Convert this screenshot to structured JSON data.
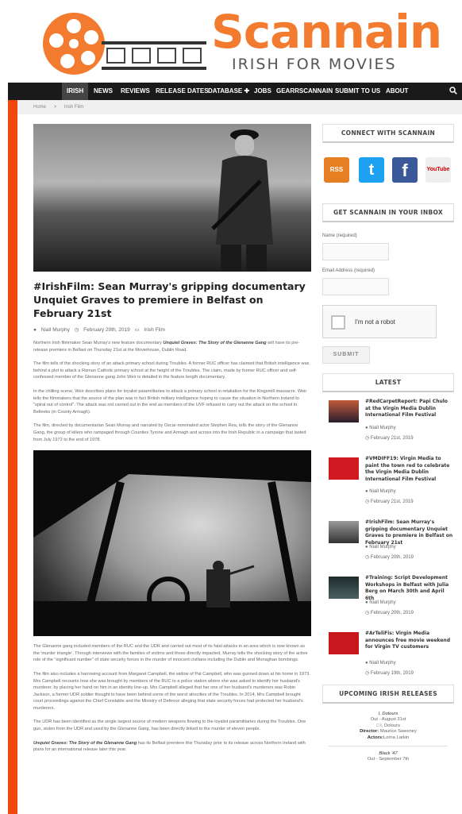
{
  "header": {
    "logo_word": "Scannain",
    "logo_sub": "IRISH FOR MOVIES"
  },
  "nav": {
    "items": [
      "Irish",
      "News",
      "Reviews",
      "Release Dates",
      "Database ✚",
      "Jobs",
      "Gearrscannain",
      "Submit to Us",
      "About"
    ]
  },
  "breadcrumb": {
    "home": "Home",
    "sep": ">",
    "current": "Irish Film"
  },
  "article": {
    "title": "#IrishFilm: Sean Murray's gripping documentary Unquiet Graves to premiere in Belfast on February 21st",
    "author": "Niall Murphy",
    "date": "February 20th, 2019",
    "category": "Irish Film",
    "p1_start": "Northern Irish filmmaker Sean Murray's new feature documentary ",
    "p1_em": "Unquiet Graves: The Story of the Glenanne Gang",
    "p1_end": " will have its pre-release premiere in Belfast on Thursday 21st at the Moviehouse, Dublin Road.",
    "p2": "The film tells of the shocking story of an attack primary school during Troubles. A former RUC officer has claimed that British intelligence was behind a plot to attack a Roman Catholic primary school at the height of the Troubles. The claim, made by former RUC officer and self-confessed member of the Glenanne gang John Weir is detailed in the feature length documentary.",
    "p3": "In the chilling scene, Weir describes plans for loyalist paramilitaries to attack a primary school in retaliation for the Kingsmill massacre. Weir tells the filmmakers that the source of the plan was in fact British military intelligence hoping to cause the situation in Northern Ireland to \"spiral out of control\". The attack was not carried out in the end as members of the UVF refused to carry out the attack on the school in Belleeks (in County Armagh).",
    "p4": "The film, directed by documentarian Sean Murray and narrated by Oscar-nominated actor Stephen Rea, tells the story of the Glenanne Gang, the group of killers who rampaged through Counties Tyrone and Armagh and across into the Irish Republic in a campaign that lasted from July 1972 to the end of 1978.",
    "p5": "The Glenanne gang included members of the RUC and the UDR and carried out most of its fatal attacks in an area which is now known as the 'murder triangle'. Through interviews with the families of victims and those directly impacted, Murray tells the shocking story of the active role of the \"significant number\" of state security forces in the murder of innocent civilians including the Dublin and Monaghan bombings.",
    "p6": "The film also includes a harrowing account from Margaret Campbell, the widow of Pat Campbell, who was gunned down at his home in 1973. Mrs Campbell recounts how she was brought by members of the RUC to a police station where she was asked to identify her husband's murderer, by placing her hand on him in an identity line-up. Mrs Campbell alleged that her one of her husband's murderers was Robin Jackson, a former UDR soldier thought to have been behind some of the worst atrocities of the Troubles. In 2014, Mrs Campbell brought court proceedings against the Chief Constable and the Ministry of Defence alleging that state security forces had protected her husband's murderers.",
    "p7": "The UDR has been identified as the single largest source of modern weapons flowing to the loyalist paramilitaries during the Troubles. One gun, stolen from the UDR and used by the Glenanne Gang, has been directly linked to the murder of eleven people.",
    "p8_em": "Unquiet Graves: The Story of the Glenanne Gang",
    "p8_end": " has its Belfast premiere this Thursday prior to its release across Northern Ireland with plans for an international release later this year."
  },
  "sidebar": {
    "connect_head": "CONNECT WITH SCANNAIN",
    "social": {
      "rss": "RSS",
      "twitter": "t",
      "facebook": "f",
      "youtube": "YouTube"
    },
    "inbox_head": "GET SCANNAIN IN YOUR INBOX",
    "name_label": "Name (required)",
    "email_label": "Email Address (required)",
    "captcha_label": "I'm not a robot",
    "submit_label": "SUBMIT",
    "latest_head": "LATEST",
    "latest": [
      {
        "title": "#RedCarpetReport: Papi Chulo at the Virgin Media Dublin International Film Festival",
        "author": "Niall Murphy",
        "date": "February 21st, 2019"
      },
      {
        "title": "#VMDIFF19: Virgin Media to paint the town red to celebrate the Virgin Media Dublin International Film Festival",
        "author": "Niall Murphy",
        "date": "February 21st, 2019"
      },
      {
        "title": "#IrishFilm: Sean Murray's gripping documentary Unquiet Graves to premiere in Belfast on February 21st",
        "author": "Niall Murphy",
        "date": "February 20th, 2019"
      },
      {
        "title": "#Training: Script Development Workshops in Belfast with Julia Berg on March 30th and April 6th",
        "author": "Niall Murphy",
        "date": "February 20th, 2019"
      },
      {
        "title": "#ArTeliFis: Virgin Media announces free movie weekend for Virgin TV customers",
        "author": "Niall Murphy",
        "date": "February 19th, 2019"
      }
    ],
    "upcoming_head": "UPCOMING IRISH RELEASES",
    "release1": {
      "title": "I, Dolours",
      "out": "Out - August 31st",
      "img_alt": "I, Dolours",
      "director_label": "Director:",
      "director": "Maurice Sweeney",
      "actors_label": "Actors:",
      "actors": "Lorna Larkin"
    },
    "release2": {
      "title": "Black '47",
      "out": "Out - September 7th"
    }
  },
  "colors": {
    "accent": "#f37b30",
    "bar": "#f2460f",
    "nav": "#1a1a1a"
  }
}
